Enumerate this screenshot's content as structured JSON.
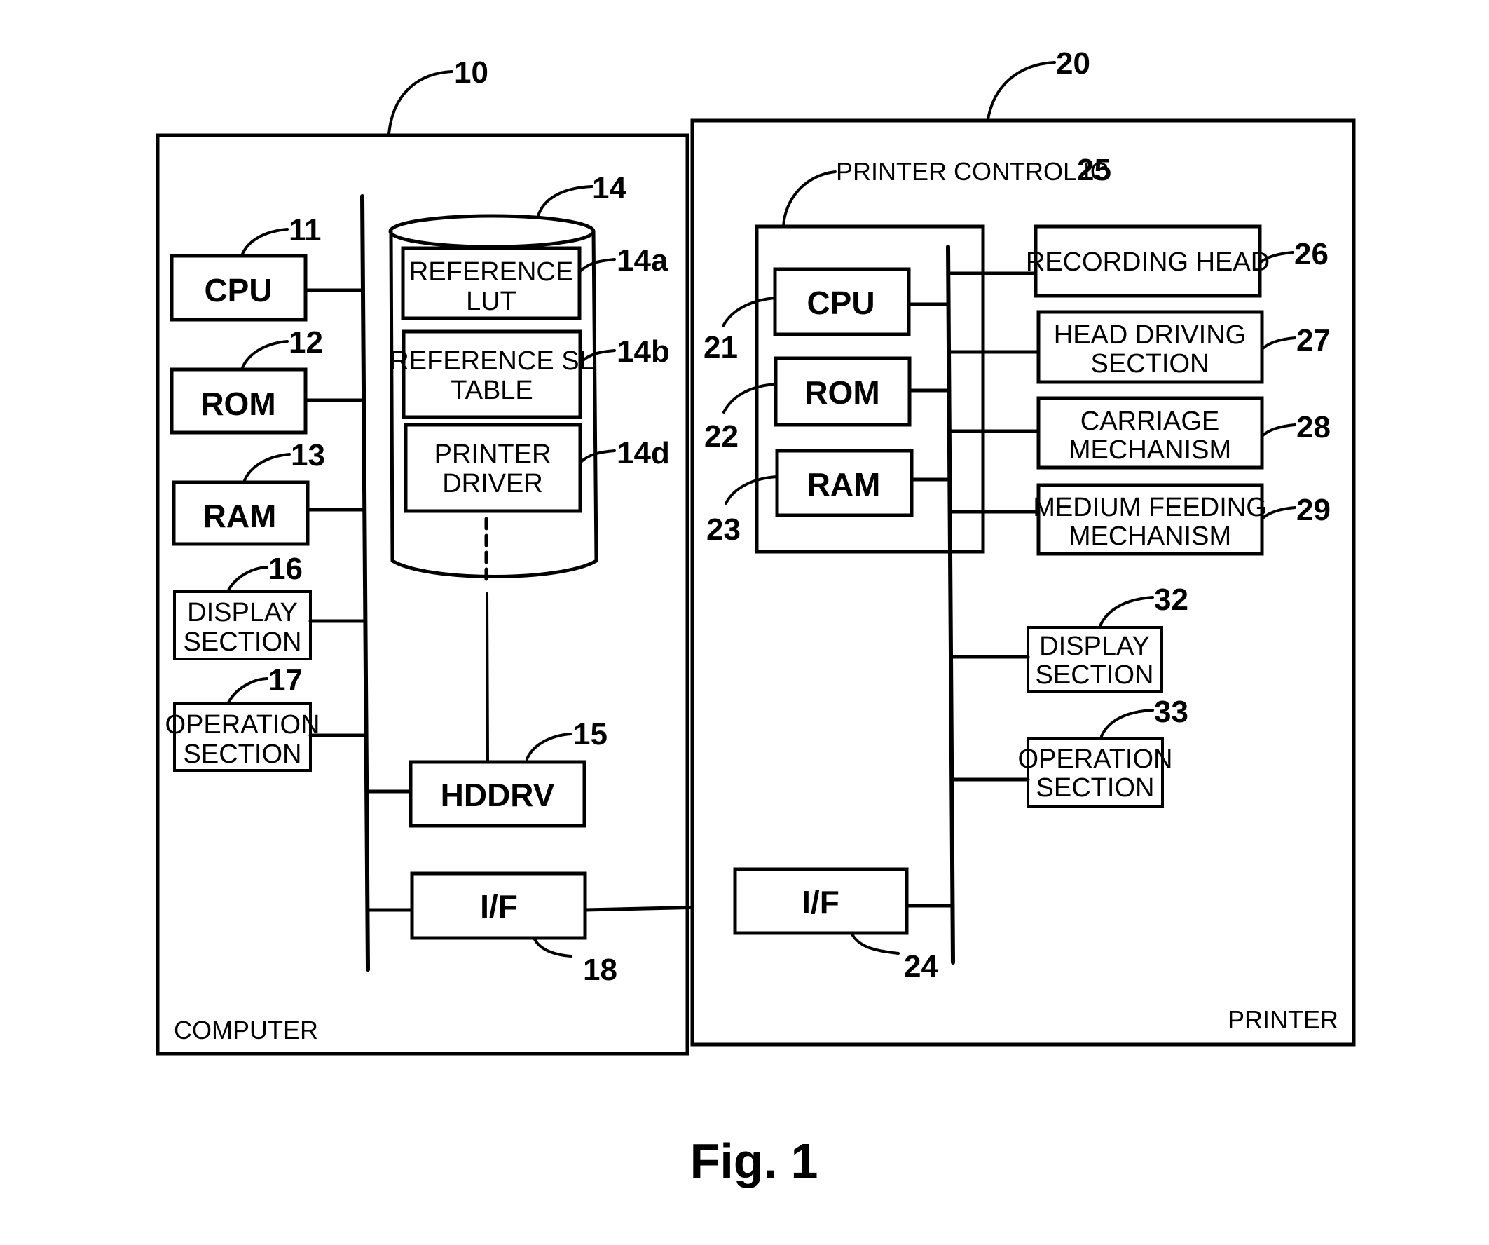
{
  "figure": {
    "caption": "Fig. 1",
    "computer": {
      "ref": "10",
      "label": "COMPUTER",
      "cpu": {
        "label": "CPU",
        "ref": "11"
      },
      "rom": {
        "label": "ROM",
        "ref": "12"
      },
      "ram": {
        "label": "RAM",
        "ref": "13"
      },
      "display": {
        "line1": "DISPLAY",
        "line2": "SECTION",
        "ref": "16"
      },
      "operation": {
        "line1": "OPERATION",
        "line2": "SECTION",
        "ref": "17"
      },
      "storage": {
        "ref": "14",
        "reference_lut": {
          "line1": "REFERENCE",
          "line2": "LUT",
          "ref": "14a"
        },
        "reference_sl_table": {
          "line1": "REFERENCE SL",
          "line2": "TABLE",
          "ref": "14b"
        },
        "printer_driver": {
          "line1": "PRINTER",
          "line2": "DRIVER",
          "ref": "14d"
        }
      },
      "hddrv": {
        "label": "HDDRV",
        "ref": "15"
      },
      "interface": {
        "label": "I/F",
        "ref": "18"
      }
    },
    "printer": {
      "ref": "20",
      "label": "PRINTER",
      "control_ic": {
        "label": "PRINTER CONTROL IC",
        "ref": "25"
      },
      "cpu": {
        "label": "CPU",
        "ref": "21"
      },
      "rom": {
        "label": "ROM",
        "ref": "22"
      },
      "ram": {
        "label": "RAM",
        "ref": "23"
      },
      "interface": {
        "label": "I/F",
        "ref": "24"
      },
      "recording_head": {
        "label": "RECORDING HEAD",
        "ref": "26"
      },
      "head_driving": {
        "line1": "HEAD DRIVING",
        "line2": "SECTION",
        "ref": "27"
      },
      "carriage": {
        "line1": "CARRIAGE",
        "line2": "MECHANISM",
        "ref": "28"
      },
      "medium_feeding": {
        "line1": "MEDIUM FEEDING",
        "line2": "MECHANISM",
        "ref": "29"
      },
      "display": {
        "line1": "DISPLAY",
        "line2": "SECTION",
        "ref": "32"
      },
      "operation": {
        "line1": "OPERATION",
        "line2": "SECTION",
        "ref": "33"
      }
    }
  }
}
